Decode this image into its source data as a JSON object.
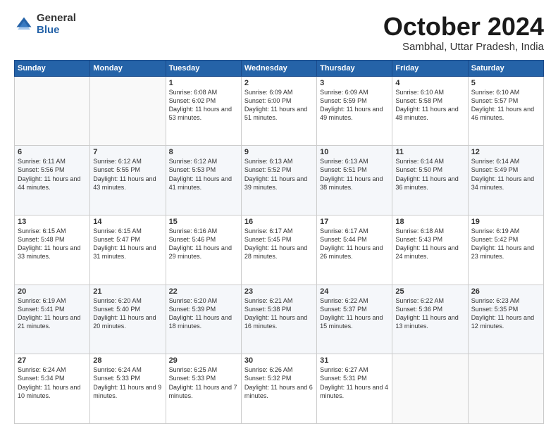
{
  "logo": {
    "general": "General",
    "blue": "Blue"
  },
  "title": {
    "month": "October 2024",
    "location": "Sambhal, Uttar Pradesh, India"
  },
  "headers": [
    "Sunday",
    "Monday",
    "Tuesday",
    "Wednesday",
    "Thursday",
    "Friday",
    "Saturday"
  ],
  "weeks": [
    [
      {
        "day": "",
        "info": ""
      },
      {
        "day": "",
        "info": ""
      },
      {
        "day": "1",
        "info": "Sunrise: 6:08 AM\nSunset: 6:02 PM\nDaylight: 11 hours and 53 minutes."
      },
      {
        "day": "2",
        "info": "Sunrise: 6:09 AM\nSunset: 6:00 PM\nDaylight: 11 hours and 51 minutes."
      },
      {
        "day": "3",
        "info": "Sunrise: 6:09 AM\nSunset: 5:59 PM\nDaylight: 11 hours and 49 minutes."
      },
      {
        "day": "4",
        "info": "Sunrise: 6:10 AM\nSunset: 5:58 PM\nDaylight: 11 hours and 48 minutes."
      },
      {
        "day": "5",
        "info": "Sunrise: 6:10 AM\nSunset: 5:57 PM\nDaylight: 11 hours and 46 minutes."
      }
    ],
    [
      {
        "day": "6",
        "info": "Sunrise: 6:11 AM\nSunset: 5:56 PM\nDaylight: 11 hours and 44 minutes."
      },
      {
        "day": "7",
        "info": "Sunrise: 6:12 AM\nSunset: 5:55 PM\nDaylight: 11 hours and 43 minutes."
      },
      {
        "day": "8",
        "info": "Sunrise: 6:12 AM\nSunset: 5:53 PM\nDaylight: 11 hours and 41 minutes."
      },
      {
        "day": "9",
        "info": "Sunrise: 6:13 AM\nSunset: 5:52 PM\nDaylight: 11 hours and 39 minutes."
      },
      {
        "day": "10",
        "info": "Sunrise: 6:13 AM\nSunset: 5:51 PM\nDaylight: 11 hours and 38 minutes."
      },
      {
        "day": "11",
        "info": "Sunrise: 6:14 AM\nSunset: 5:50 PM\nDaylight: 11 hours and 36 minutes."
      },
      {
        "day": "12",
        "info": "Sunrise: 6:14 AM\nSunset: 5:49 PM\nDaylight: 11 hours and 34 minutes."
      }
    ],
    [
      {
        "day": "13",
        "info": "Sunrise: 6:15 AM\nSunset: 5:48 PM\nDaylight: 11 hours and 33 minutes."
      },
      {
        "day": "14",
        "info": "Sunrise: 6:15 AM\nSunset: 5:47 PM\nDaylight: 11 hours and 31 minutes."
      },
      {
        "day": "15",
        "info": "Sunrise: 6:16 AM\nSunset: 5:46 PM\nDaylight: 11 hours and 29 minutes."
      },
      {
        "day": "16",
        "info": "Sunrise: 6:17 AM\nSunset: 5:45 PM\nDaylight: 11 hours and 28 minutes."
      },
      {
        "day": "17",
        "info": "Sunrise: 6:17 AM\nSunset: 5:44 PM\nDaylight: 11 hours and 26 minutes."
      },
      {
        "day": "18",
        "info": "Sunrise: 6:18 AM\nSunset: 5:43 PM\nDaylight: 11 hours and 24 minutes."
      },
      {
        "day": "19",
        "info": "Sunrise: 6:19 AM\nSunset: 5:42 PM\nDaylight: 11 hours and 23 minutes."
      }
    ],
    [
      {
        "day": "20",
        "info": "Sunrise: 6:19 AM\nSunset: 5:41 PM\nDaylight: 11 hours and 21 minutes."
      },
      {
        "day": "21",
        "info": "Sunrise: 6:20 AM\nSunset: 5:40 PM\nDaylight: 11 hours and 20 minutes."
      },
      {
        "day": "22",
        "info": "Sunrise: 6:20 AM\nSunset: 5:39 PM\nDaylight: 11 hours and 18 minutes."
      },
      {
        "day": "23",
        "info": "Sunrise: 6:21 AM\nSunset: 5:38 PM\nDaylight: 11 hours and 16 minutes."
      },
      {
        "day": "24",
        "info": "Sunrise: 6:22 AM\nSunset: 5:37 PM\nDaylight: 11 hours and 15 minutes."
      },
      {
        "day": "25",
        "info": "Sunrise: 6:22 AM\nSunset: 5:36 PM\nDaylight: 11 hours and 13 minutes."
      },
      {
        "day": "26",
        "info": "Sunrise: 6:23 AM\nSunset: 5:35 PM\nDaylight: 11 hours and 12 minutes."
      }
    ],
    [
      {
        "day": "27",
        "info": "Sunrise: 6:24 AM\nSunset: 5:34 PM\nDaylight: 11 hours and 10 minutes."
      },
      {
        "day": "28",
        "info": "Sunrise: 6:24 AM\nSunset: 5:33 PM\nDaylight: 11 hours and 9 minutes."
      },
      {
        "day": "29",
        "info": "Sunrise: 6:25 AM\nSunset: 5:33 PM\nDaylight: 11 hours and 7 minutes."
      },
      {
        "day": "30",
        "info": "Sunrise: 6:26 AM\nSunset: 5:32 PM\nDaylight: 11 hours and 6 minutes."
      },
      {
        "day": "31",
        "info": "Sunrise: 6:27 AM\nSunset: 5:31 PM\nDaylight: 11 hours and 4 minutes."
      },
      {
        "day": "",
        "info": ""
      },
      {
        "day": "",
        "info": ""
      }
    ]
  ]
}
